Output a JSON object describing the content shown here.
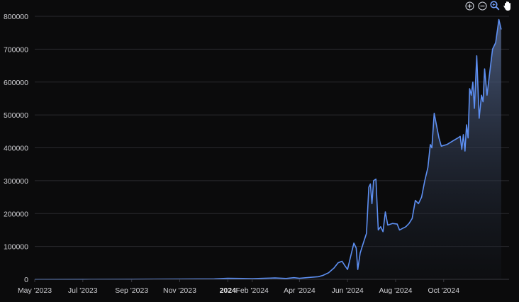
{
  "toolbar": {
    "icons": [
      "zoom-in-icon",
      "zoom-out-icon",
      "magnifier-zoom-icon",
      "pan-hand-icon"
    ]
  },
  "colors": {
    "background": "#0b0b0c",
    "line": "#5d8ff2",
    "area_top": "#4a5f86",
    "gridline": "#2a2a2e",
    "tick_text": "#cfcfd3"
  },
  "chart_data": {
    "type": "area",
    "title": "",
    "xlabel": "",
    "ylabel": "",
    "ylim": [
      0,
      800000
    ],
    "xlim": [
      "2023-05-01",
      "2024-12-23"
    ],
    "grid": true,
    "y_ticks": [
      "0",
      "100000",
      "200000",
      "300000",
      "400000",
      "500000",
      "600000",
      "700000",
      "800000"
    ],
    "x_ticks": [
      {
        "date": "2023-05-01",
        "label": "May '2023",
        "bold": false
      },
      {
        "date": "2023-07-01",
        "label": "Jul '2023",
        "bold": false
      },
      {
        "date": "2023-09-01",
        "label": "Sep '2023",
        "bold": false
      },
      {
        "date": "2023-11-01",
        "label": "Nov '2023",
        "bold": false
      },
      {
        "date": "2024-01-01",
        "label": "2024",
        "bold": true
      },
      {
        "date": "2024-02-01",
        "label": "Feb '2024",
        "bold": false
      },
      {
        "date": "2024-04-01",
        "label": "Apr '2024",
        "bold": false
      },
      {
        "date": "2024-06-01",
        "label": "Jun '2024",
        "bold": false
      },
      {
        "date": "2024-08-01",
        "label": "Aug '2024",
        "bold": false
      },
      {
        "date": "2024-10-01",
        "label": "Oct '2024",
        "bold": false
      }
    ],
    "series": [
      {
        "points": [
          [
            "2023-05-01",
            0
          ],
          [
            "2023-07-01",
            200
          ],
          [
            "2023-09-01",
            400
          ],
          [
            "2023-11-01",
            900
          ],
          [
            "2023-12-15",
            1500
          ],
          [
            "2024-01-01",
            3000
          ],
          [
            "2024-01-20",
            2500
          ],
          [
            "2024-02-01",
            2000
          ],
          [
            "2024-02-20",
            3500
          ],
          [
            "2024-03-01",
            4000
          ],
          [
            "2024-03-15",
            2500
          ],
          [
            "2024-03-25",
            5000
          ],
          [
            "2024-04-01",
            3000
          ],
          [
            "2024-04-15",
            6000
          ],
          [
            "2024-04-25",
            8000
          ],
          [
            "2024-05-01",
            12000
          ],
          [
            "2024-05-08",
            20000
          ],
          [
            "2024-05-15",
            35000
          ],
          [
            "2024-05-20",
            50000
          ],
          [
            "2024-05-25",
            55000
          ],
          [
            "2024-05-29",
            40000
          ],
          [
            "2024-06-01",
            30000
          ],
          [
            "2024-06-05",
            70000
          ],
          [
            "2024-06-09",
            110000
          ],
          [
            "2024-06-12",
            95000
          ],
          [
            "2024-06-14",
            30000
          ],
          [
            "2024-06-17",
            80000
          ],
          [
            "2024-06-21",
            110000
          ],
          [
            "2024-06-25",
            140000
          ],
          [
            "2024-06-28",
            280000
          ],
          [
            "2024-06-30",
            290000
          ],
          [
            "2024-07-02",
            230000
          ],
          [
            "2024-07-04",
            300000
          ],
          [
            "2024-07-07",
            305000
          ],
          [
            "2024-07-10",
            150000
          ],
          [
            "2024-07-13",
            160000
          ],
          [
            "2024-07-16",
            145000
          ],
          [
            "2024-07-19",
            205000
          ],
          [
            "2024-07-22",
            165000
          ],
          [
            "2024-07-28",
            170000
          ],
          [
            "2024-08-03",
            168000
          ],
          [
            "2024-08-06",
            150000
          ],
          [
            "2024-08-10",
            155000
          ],
          [
            "2024-08-14",
            160000
          ],
          [
            "2024-08-18",
            170000
          ],
          [
            "2024-08-22",
            185000
          ],
          [
            "2024-08-26",
            240000
          ],
          [
            "2024-08-30",
            230000
          ],
          [
            "2024-09-03",
            250000
          ],
          [
            "2024-09-07",
            300000
          ],
          [
            "2024-09-11",
            340000
          ],
          [
            "2024-09-14",
            410000
          ],
          [
            "2024-09-16",
            400000
          ],
          [
            "2024-09-19",
            505000
          ],
          [
            "2024-09-21",
            480000
          ],
          [
            "2024-09-25",
            430000
          ],
          [
            "2024-09-28",
            405000
          ],
          [
            "2024-10-05",
            410000
          ],
          [
            "2024-10-12",
            420000
          ],
          [
            "2024-10-19",
            430000
          ],
          [
            "2024-10-22",
            435000
          ],
          [
            "2024-10-24",
            395000
          ],
          [
            "2024-10-26",
            440000
          ],
          [
            "2024-10-28",
            390000
          ],
          [
            "2024-10-30",
            470000
          ],
          [
            "2024-11-01",
            430000
          ],
          [
            "2024-11-03",
            580000
          ],
          [
            "2024-11-05",
            560000
          ],
          [
            "2024-11-07",
            600000
          ],
          [
            "2024-11-09",
            520000
          ],
          [
            "2024-11-12",
            680000
          ],
          [
            "2024-11-15",
            490000
          ],
          [
            "2024-11-18",
            560000
          ],
          [
            "2024-11-20",
            540000
          ],
          [
            "2024-11-22",
            640000
          ],
          [
            "2024-11-25",
            560000
          ],
          [
            "2024-11-28",
            620000
          ],
          [
            "2024-12-02",
            700000
          ],
          [
            "2024-12-06",
            720000
          ],
          [
            "2024-12-10",
            790000
          ],
          [
            "2024-12-13",
            760000
          ]
        ]
      }
    ]
  }
}
